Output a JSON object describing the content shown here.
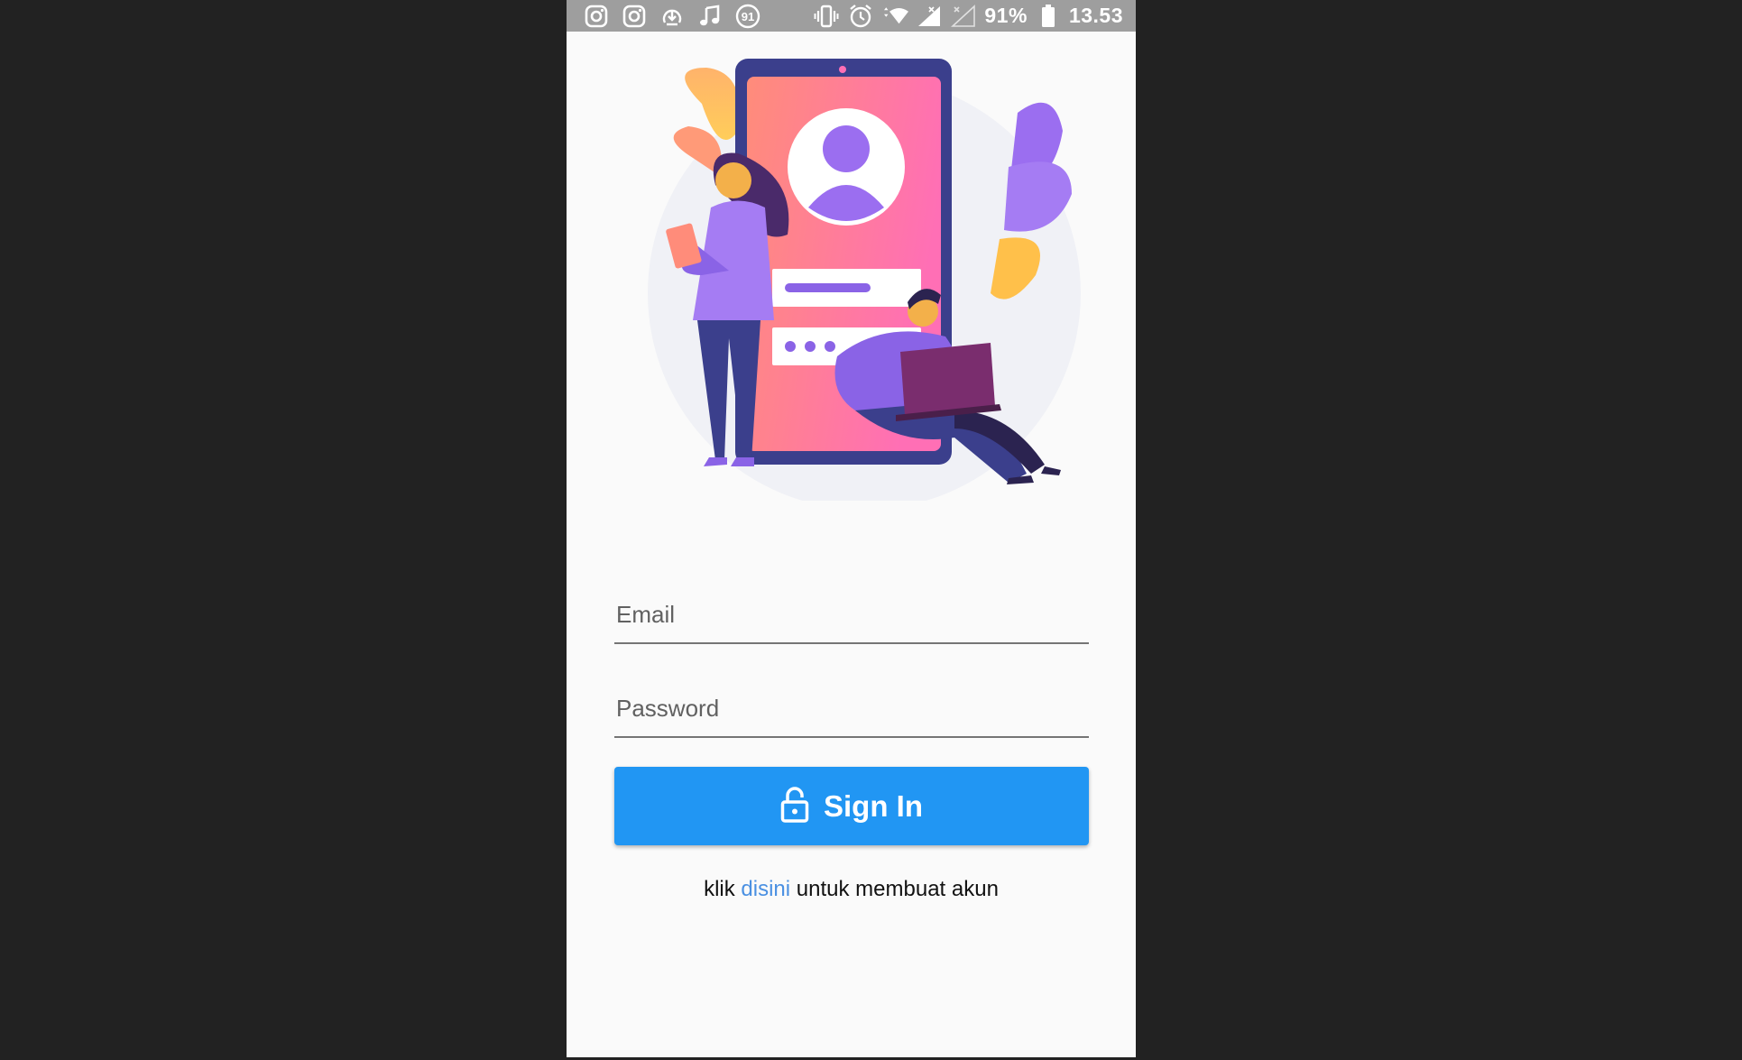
{
  "status_bar": {
    "left_icons": [
      "instagram-icon",
      "instagram-icon",
      "download-icon",
      "music-note-icon",
      "notification-count-icon"
    ],
    "notification_count": "91",
    "right_icons": [
      "vibrate-icon",
      "alarm-icon",
      "wifi-icon",
      "signal-icon",
      "signal-off-icon"
    ],
    "battery": "91%",
    "time": "13.53"
  },
  "illustration": {
    "colors": {
      "primary": "#8a63e6",
      "accent": "#ff7aa8",
      "phone_frame": "#3b3f8c",
      "leaf": "#f9b84a"
    }
  },
  "form": {
    "email_placeholder": "Email",
    "password_placeholder": "Password",
    "signin_label": "Sign In",
    "signin_icon": "lock-open-icon",
    "button_color": "#2196f3"
  },
  "register": {
    "prefix": "klik",
    "link": "disini",
    "suffix": "untuk membuat akun",
    "link_color": "#4a90e2"
  }
}
